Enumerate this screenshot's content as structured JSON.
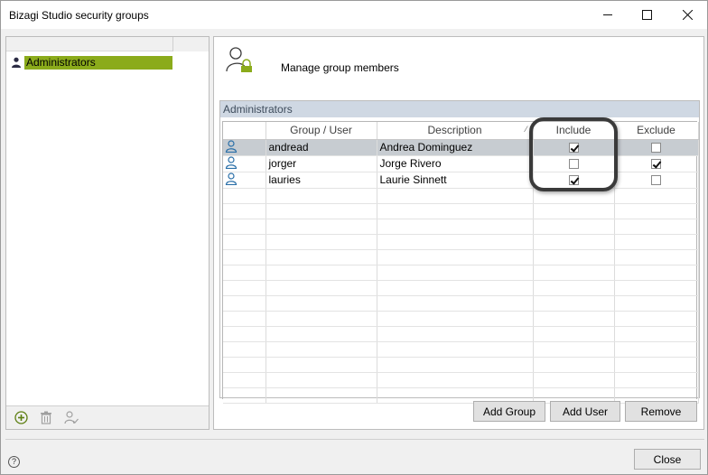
{
  "window": {
    "title": "Bizagi Studio security groups"
  },
  "titlebar_buttons": {
    "minimize": "minimize-icon",
    "maximize": "maximize-icon",
    "close": "close-icon"
  },
  "tree": {
    "items": [
      {
        "label": "Administrators",
        "icon": "user-group-icon",
        "selected": true
      }
    ]
  },
  "left_toolbar": {
    "add": "add-icon",
    "delete": "trash-icon",
    "user": "user-check-icon"
  },
  "right_panel": {
    "header_icon": "user-lock-icon",
    "heading": "Manage group members",
    "grid_caption": "Administrators",
    "columns": [
      "",
      "Group / User",
      "Description",
      "Include",
      "Exclude"
    ],
    "sort_glyph": "⁄",
    "rows": [
      {
        "user": "andread",
        "description": "Andrea Dominguez",
        "include": true,
        "exclude": false,
        "selected": true
      },
      {
        "user": "jorger",
        "description": "Jorge Rivero",
        "include": false,
        "exclude": true,
        "selected": false
      },
      {
        "user": "lauries",
        "description": "Laurie Sinnett",
        "include": true,
        "exclude": false,
        "selected": false
      }
    ],
    "empty_rows": 14,
    "buttons": {
      "add_group": "Add Group",
      "add_user": "Add User",
      "remove": "Remove"
    }
  },
  "footer": {
    "help": "?",
    "close": "Close"
  },
  "colors": {
    "selection": "#8bab1b",
    "caption_bg": "#cfd8e3",
    "selected_row": "#c7ccd1"
  }
}
